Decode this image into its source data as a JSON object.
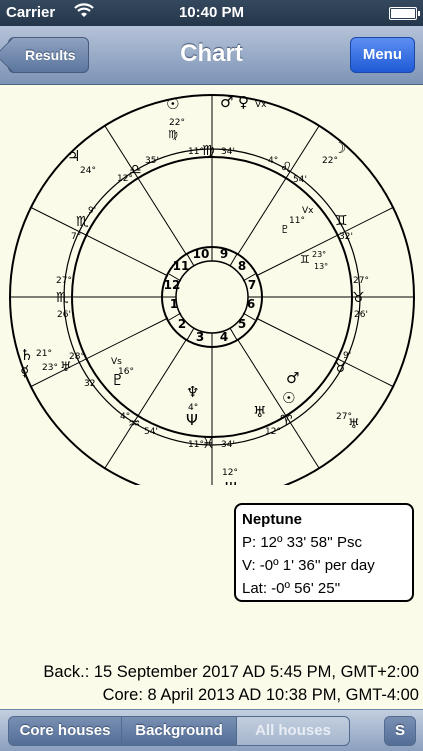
{
  "status": {
    "carrier": "Carrier",
    "time": "10:40 PM"
  },
  "nav": {
    "back_label": "Results",
    "title": "Chart",
    "menu_label": "Menu"
  },
  "chart": {
    "house_numbers": [
      "1",
      "2",
      "3",
      "4",
      "5",
      "6",
      "7",
      "8",
      "9",
      "10",
      "11",
      "12"
    ],
    "cusp_degrees": {
      "mc": "11°",
      "mc_sign": "♍",
      "mc_min": "34'",
      "ic": "11°",
      "ic_sign": "♓",
      "ic_min": "34'",
      "asc_left": "27°",
      "asc_left_sign": "♏",
      "asc_left_min": "26'",
      "desc_right": "27°",
      "desc_right_sign": "♉",
      "desc_right_min": "26'",
      "c12_deg": "12°",
      "c12_sign": "♎",
      "c12_min": "35'",
      "c11_deg": "4°",
      "c11_sign": "♌",
      "c11_min": "54'",
      "c10_deg": "9'",
      "c10_sign": "♏",
      "c10_min": "7°",
      "c9_deg": "32'",
      "c9_sign": "♊",
      "c9_min": "",
      "c3_deg": "9'",
      "c3_sign": "♉",
      "c2_deg": "32",
      "c2_sign": "♐",
      "c6_deg": "4°",
      "c6_sign": "♒",
      "c6_min": "54'",
      "c5_deg": "12°",
      "c5_sign": "♈",
      "c5_min": "35'"
    },
    "planets": {
      "sun_top": "☉",
      "sun_top_deg": "22°",
      "sun_top_sign": "♍",
      "mars_top": "♂",
      "venus_top": "♀",
      "vx_top": "Vx",
      "jupiter_top": "♃",
      "jupiter_deg": "24°",
      "moon_top": "☽",
      "moon_deg": "22°",
      "vx_right": "Vx",
      "pluto_right": "♇",
      "pluto_deg": "11°",
      "node_right": "♊",
      "node_deg1": "23°",
      "node_deg2": "13°",
      "mercury_left": "☿",
      "saturn_left": "♄",
      "saturn_deg": "21°",
      "venus_left": "♀",
      "venus_left_deg": "23°",
      "uranus_left": "♅",
      "uranus_deg": "28°",
      "vs_left": "Vs",
      "pluto_left": "♇",
      "pluto_left_deg": "16°",
      "neptune_bottom": "Ψ",
      "neptune_deg": "12°",
      "mars_right": "♂",
      "mercury_right": "♀",
      "sun_right": "☉",
      "chiron_right": "♅",
      "chiron_deg": "27°",
      "ceres_bottom": "♆",
      "ceres_deg": "4°",
      "neptune_inner": "Ψ",
      "uranus_inner": "♅"
    }
  },
  "tooltip": {
    "name": "Neptune",
    "position": "P: 12º 33' 58'' Psc",
    "velocity": "V: -0º 1' 36'' per day",
    "latitude": "Lat: -0º 56' 25''"
  },
  "footer": {
    "background": "Back.: 15 September 2017 AD 5:45 PM, GMT+2:00",
    "core": "Core: 8 April 2013 AD 10:38 PM, GMT-4:00"
  },
  "tabbar": {
    "core_houses": "Core houses",
    "background": "Background",
    "all_houses": "All houses",
    "s_button": "S"
  }
}
